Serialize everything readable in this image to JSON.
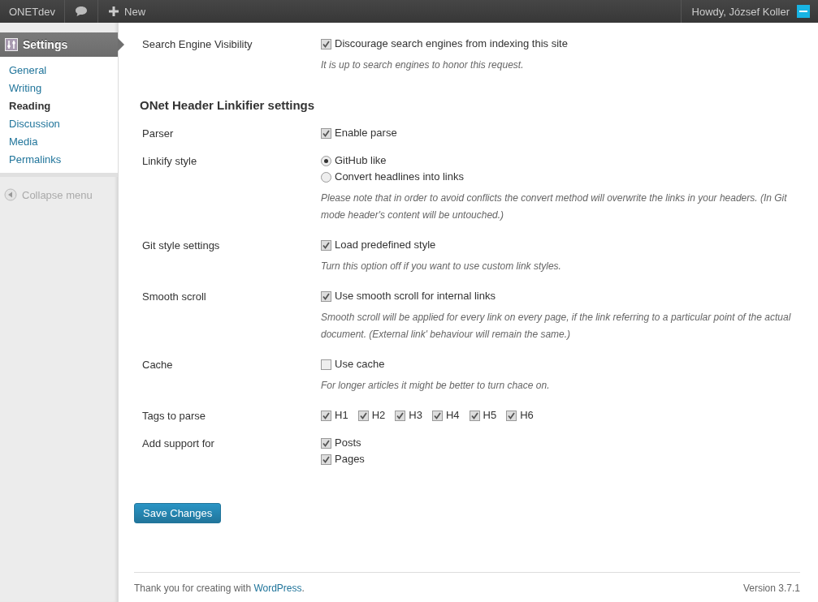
{
  "admin_bar": {
    "site_name": "ONETdev",
    "new_label": "New",
    "greeting": "Howdy, József Koller"
  },
  "sidebar": {
    "current": {
      "label": "Settings"
    },
    "items": [
      {
        "label": "General",
        "selected": false
      },
      {
        "label": "Writing",
        "selected": false
      },
      {
        "label": "Reading",
        "selected": true
      },
      {
        "label": "Discussion",
        "selected": false
      },
      {
        "label": "Media",
        "selected": false
      },
      {
        "label": "Permalinks",
        "selected": false
      }
    ],
    "collapse": "Collapse menu"
  },
  "sections": [
    {
      "rows": [
        {
          "label": "Search Engine Visibility",
          "kind": "checkbox",
          "options": [
            {
              "label": "Discourage search engines from indexing this site",
              "checked": true
            }
          ],
          "description": [
            "It is up to search engines to honor this request."
          ]
        }
      ]
    },
    {
      "heading": "ONet Header Linkifier settings",
      "rows": [
        {
          "label": "Parser",
          "kind": "checkbox",
          "options": [
            {
              "label": "Enable parse",
              "checked": true
            }
          ]
        },
        {
          "label": "Linkify style",
          "kind": "radio",
          "options": [
            {
              "label": "GitHub like",
              "selected": true
            },
            {
              "label": "Convert headlines into links",
              "selected": false
            }
          ],
          "description": [
            "Please note that in order to avoid conflicts the convert method will overwrite the links in your headers. (In Git mode header's content will be untouched.)"
          ]
        },
        {
          "label": "Git style settings",
          "kind": "checkbox",
          "options": [
            {
              "label": "Load predefined style",
              "checked": true
            }
          ],
          "description": [
            "Turn this option off if you want to use custom link styles."
          ]
        },
        {
          "label": "Smooth scroll",
          "kind": "checkbox",
          "options": [
            {
              "label": "Use smooth scroll for internal links",
              "checked": true
            }
          ],
          "description": [
            "Smooth scroll will be applied for every link on every page, if the link referring to a particular point of the actual document. (External link' behaviour will remain the same.)"
          ]
        },
        {
          "label": "Cache",
          "kind": "checkbox",
          "options": [
            {
              "label": "Use cache",
              "checked": false
            }
          ],
          "description": [
            "For longer articles it might be better to turn chace on."
          ]
        },
        {
          "label": "Tags to parse",
          "kind": "inline",
          "options": [
            {
              "label": "H1",
              "checked": true
            },
            {
              "label": "H2",
              "checked": true
            },
            {
              "label": "H3",
              "checked": true
            },
            {
              "label": "H4",
              "checked": true
            },
            {
              "label": "H5",
              "checked": true
            },
            {
              "label": "H6",
              "checked": true
            }
          ]
        },
        {
          "label": "Add support for",
          "kind": "checkbox",
          "options": [
            {
              "label": "Posts",
              "checked": true
            },
            {
              "label": "Pages",
              "checked": true
            }
          ]
        }
      ]
    }
  ],
  "save_button": "Save Changes",
  "footer": {
    "thanks": "Thank you for creating with",
    "link": "WordPress",
    "end": ".",
    "version": "Version 3.7.1"
  }
}
